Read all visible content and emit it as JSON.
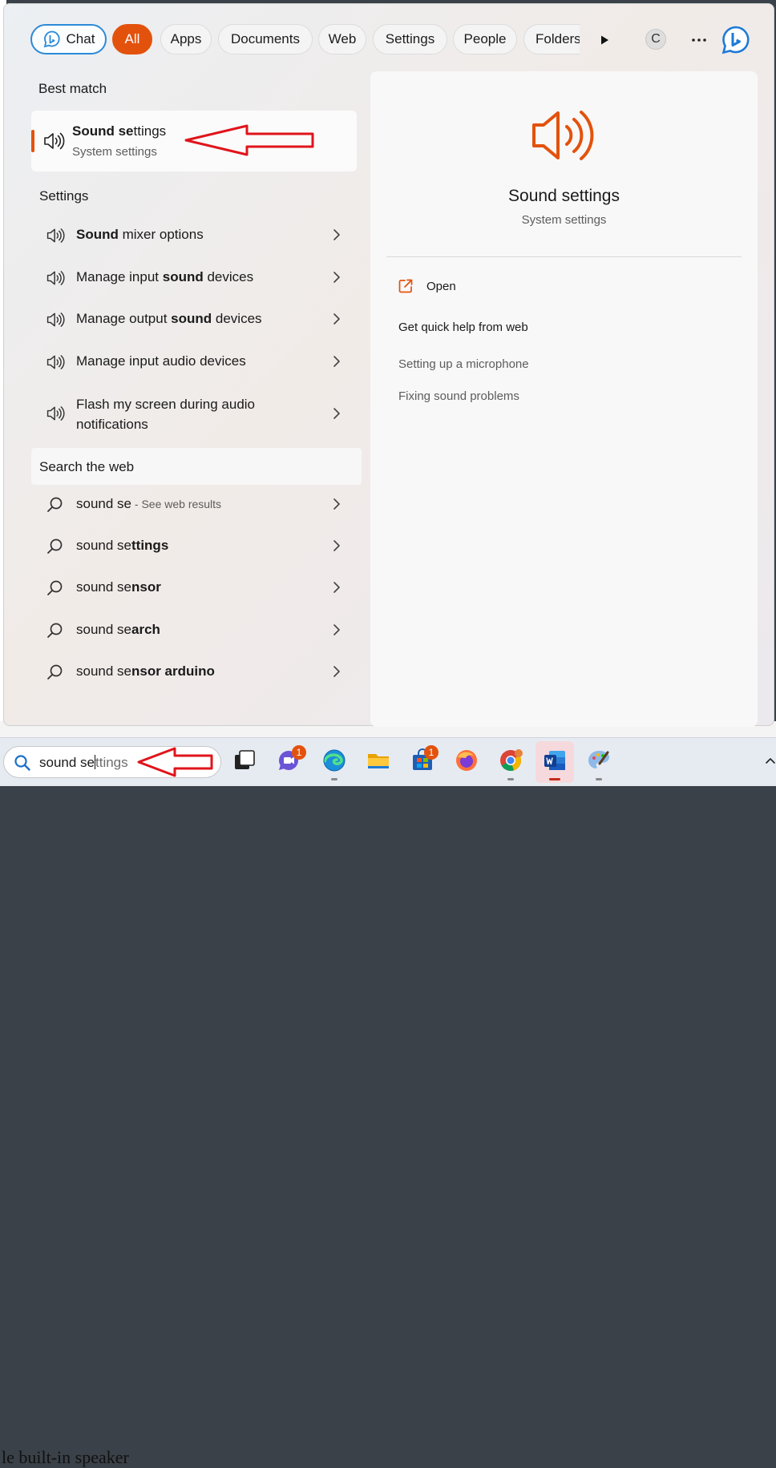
{
  "tabs": {
    "chat": "Chat",
    "all": "All",
    "apps": "Apps",
    "documents": "Documents",
    "web": "Web",
    "settings": "Settings",
    "people": "People",
    "folders": "Folders",
    "account_initial": "C"
  },
  "best_match": {
    "heading": "Best match",
    "title_bold": "Sound se",
    "title_rest": "ttings",
    "subtitle": "System settings"
  },
  "settings_section": {
    "heading": "Settings",
    "items": [
      {
        "pre": "",
        "bold": "Sound",
        "post": " mixer options"
      },
      {
        "pre": "Manage input ",
        "bold": "sound",
        "post": " devices"
      },
      {
        "pre": "Manage output ",
        "bold": "sound",
        "post": " devices"
      },
      {
        "pre": "Manage input audio devices",
        "bold": "",
        "post": ""
      },
      {
        "line1": "Flash my screen during audio",
        "line2": "notifications"
      }
    ]
  },
  "web_section": {
    "heading": "Search the web",
    "items": [
      {
        "pre": "sound se",
        "bold": "",
        "hint": " - See web results"
      },
      {
        "pre": "sound se",
        "bold": "ttings",
        "hint": ""
      },
      {
        "pre": "sound se",
        "bold": "nsor",
        "hint": ""
      },
      {
        "pre": "sound se",
        "bold": "arch",
        "hint": ""
      },
      {
        "pre": "sound se",
        "bold": "nsor arduino",
        "hint": ""
      }
    ]
  },
  "detail": {
    "title": "Sound settings",
    "subtitle": "System settings",
    "open_label": "Open",
    "help_heading": "Get quick help from web",
    "help_links": [
      "Setting up a microphone",
      "Fixing sound problems"
    ]
  },
  "taskbar": {
    "search_typed": "sound se",
    "search_suggest": "ttings",
    "teams_badge": "1",
    "store_badge": "1"
  },
  "background": {
    "text": "le built-in speaker"
  },
  "colors": {
    "accent": "#e3520d",
    "chat_border": "#2b8ad8",
    "annotation_arrow": "#e0141b"
  }
}
